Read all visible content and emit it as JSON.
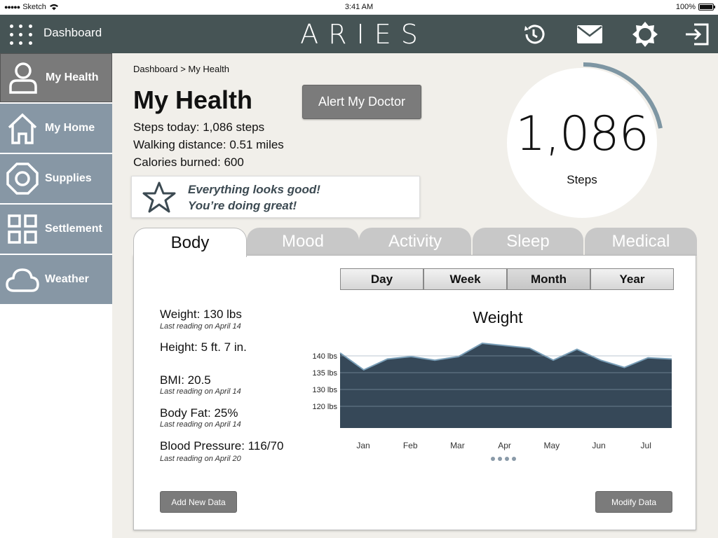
{
  "status_bar": {
    "carrier": "Sketch",
    "time": "3:41 AM",
    "battery": "100%",
    "battery_level": 1.0
  },
  "topnav": {
    "dashboard_label": "Dashboard",
    "logo": "ARIES",
    "icons": [
      "history-icon",
      "mail-icon",
      "settings-icon",
      "logout-icon"
    ]
  },
  "sidebar": {
    "items": [
      {
        "label": "My Health",
        "icon": "person-icon",
        "active": true
      },
      {
        "label": "My Home",
        "icon": "home-icon"
      },
      {
        "label": "Supplies",
        "icon": "supplies-icon"
      },
      {
        "label": "Settlement",
        "icon": "grid-icon"
      },
      {
        "label": "Weather",
        "icon": "cloud-icon"
      }
    ]
  },
  "main": {
    "breadcrumb": "Dashboard > My Health",
    "title": "My Health",
    "alert_button": "Alert My Doctor",
    "stats": [
      "Steps today: 1,086 steps",
      "Walking distance: 0.51 miles",
      "Calories burned: 600"
    ],
    "message_line1": "Everything looks good!",
    "message_line2": "You’re doing great!",
    "steps_value": "1,086",
    "steps_label": "Steps",
    "steps_progress": 0.22
  },
  "tabs": [
    "Body",
    "Mood",
    "Activity",
    "Sleep",
    "Medical"
  ],
  "periods": [
    "Day",
    "Week",
    "Month",
    "Year"
  ],
  "selected_period": "Month",
  "metrics": [
    {
      "label": "Weight: 130 lbs",
      "sub": "Last reading on April 14"
    },
    {
      "label": "Height: 5 ft. 7 in.",
      "sub": ""
    },
    {
      "label": "BMI: 20.5",
      "sub": "Last reading on April 14"
    },
    {
      "label": "Body Fat: 25%",
      "sub": "Last reading on April 14"
    },
    {
      "label": "Blood Pressure: 116/70",
      "sub": "Last reading on April 20"
    }
  ],
  "buttons": {
    "add": "Add New Data",
    "modify": "Modify Data"
  },
  "colors": {
    "nav": "#465455",
    "sidebar": "#8797a5",
    "chart_fill": "#364858",
    "chart_line": "#7a9fb8"
  },
  "chart_data": {
    "type": "area",
    "title": "Weight",
    "x": [
      "Jan",
      "",
      "Feb",
      "",
      "Mar",
      "",
      "Apr",
      "",
      "",
      "May",
      "",
      "Jun",
      "",
      "",
      "Jul",
      ""
    ],
    "x_tick_labels": [
      "Jan",
      "Feb",
      "Mar",
      "Apr",
      "May",
      "Jun",
      "Jul"
    ],
    "values": [
      141,
      134,
      138.5,
      139.5,
      138,
      139.5,
      145,
      144,
      143,
      138,
      142.5,
      138,
      135,
      139,
      138.5
    ],
    "y_tick_labels": [
      "140 lbs",
      "135 lbs",
      "130 lbs",
      "120 lbs"
    ],
    "ylim": [
      110,
      145
    ],
    "grid": true
  }
}
